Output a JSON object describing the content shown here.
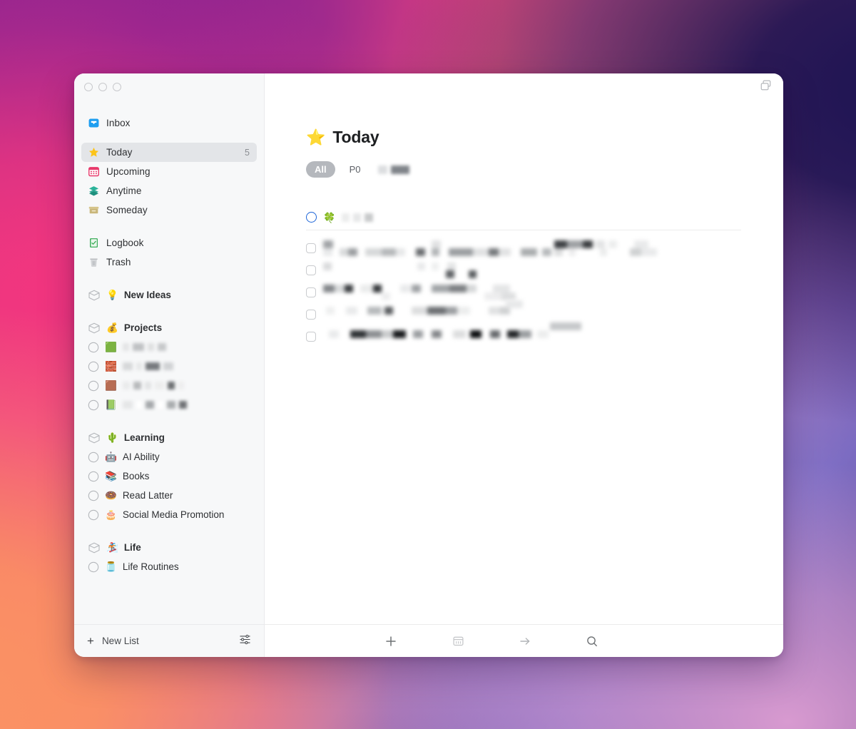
{
  "window": {
    "traffic_lights": [
      "close",
      "minimize",
      "zoom"
    ],
    "topbar_icon": "duplicate-windows-icon"
  },
  "sidebar": {
    "nav": [
      {
        "label": "Inbox",
        "icon": "inbox-tray-icon",
        "emoji": "📥",
        "count": ""
      },
      {
        "label": "Today",
        "icon": "star-icon",
        "emoji": "⭐",
        "count": "5",
        "selected": true
      },
      {
        "label": "Upcoming",
        "icon": "calendar-icon",
        "emoji": "🗓️",
        "count": ""
      },
      {
        "label": "Anytime",
        "icon": "layers-icon",
        "emoji": "📚",
        "count": ""
      },
      {
        "label": "Someday",
        "icon": "archive-box-icon",
        "emoji": "🗃️",
        "count": ""
      }
    ],
    "nav2": [
      {
        "label": "Logbook",
        "icon": "logbook-icon",
        "emoji": "📗",
        "count": ""
      },
      {
        "label": "Trash",
        "icon": "trash-icon",
        "emoji": "🗑️",
        "count": ""
      }
    ],
    "groups": [
      {
        "label": "New Ideas",
        "emoji": "💡",
        "items": []
      },
      {
        "label": "Projects",
        "emoji": "💰",
        "items": [
          {
            "label": "",
            "emoji": "🟩",
            "redacted": true
          },
          {
            "label": "",
            "emoji": "🧱",
            "redacted": true
          },
          {
            "label": "",
            "emoji": "🟫",
            "redacted": true
          },
          {
            "label": "",
            "emoji": "📗",
            "redacted": true
          }
        ]
      },
      {
        "label": "Learning",
        "emoji": "🌵",
        "items": [
          {
            "label": "AI Ability",
            "emoji": "🤖",
            "redacted": false
          },
          {
            "label": "Books",
            "emoji": "📚",
            "redacted": false
          },
          {
            "label": "Read Latter",
            "emoji": "🍩",
            "redacted": false
          },
          {
            "label": "Social Media Promotion",
            "emoji": "🎂",
            "redacted": false
          }
        ]
      },
      {
        "label": "Life",
        "emoji": "🏂",
        "items": [
          {
            "label": "Life Routines",
            "emoji": "🫙",
            "redacted": false
          }
        ]
      }
    ],
    "footer": {
      "new_list_label": "New List",
      "plus_icon": "plus-icon",
      "settings_icon": "sliders-icon"
    }
  },
  "main": {
    "title": "Today",
    "title_emoji": "⭐",
    "filters": [
      {
        "label": "All",
        "active": true
      },
      {
        "label": "P0",
        "active": false
      },
      {
        "label": "",
        "active": false,
        "redacted": true
      }
    ],
    "task_header": {
      "emoji": "🍀",
      "checkbox": "open-circle-checkbox",
      "redacted": true
    },
    "tasks": [
      {
        "checkbox": "square-checkbox",
        "redacted": true
      },
      {
        "checkbox": "square-checkbox",
        "redacted": true
      },
      {
        "checkbox": "square-checkbox",
        "redacted": true
      },
      {
        "checkbox": "square-checkbox",
        "redacted": true
      },
      {
        "checkbox": "square-checkbox",
        "redacted": true
      }
    ],
    "footer_tools": [
      {
        "icon": "plus-icon",
        "glyph": "＋"
      },
      {
        "icon": "calendar-icon",
        "glyph": "🗓"
      },
      {
        "icon": "arrow-right-icon",
        "glyph": "→"
      },
      {
        "icon": "search-icon",
        "glyph": "⌕"
      }
    ]
  },
  "colors": {
    "accent_blue": "#1c64d8",
    "pill_active_bg": "#b5b8bd",
    "sidebar_bg": "#f7f8f9",
    "selected_row_bg": "#e3e5e8"
  }
}
